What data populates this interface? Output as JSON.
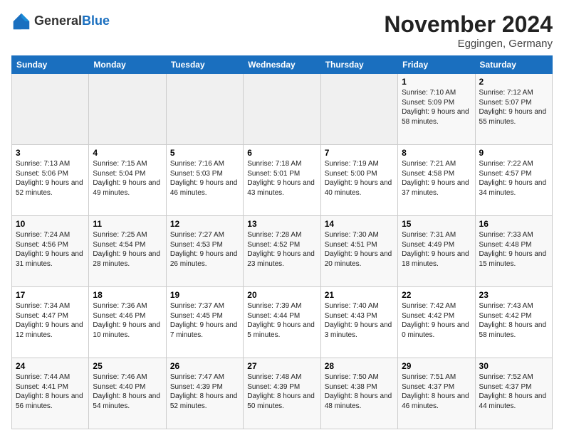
{
  "header": {
    "logo_line1": "General",
    "logo_line2": "Blue",
    "month_title": "November 2024",
    "location": "Eggingen, Germany"
  },
  "weekdays": [
    "Sunday",
    "Monday",
    "Tuesday",
    "Wednesday",
    "Thursday",
    "Friday",
    "Saturday"
  ],
  "weeks": [
    [
      {
        "day": "",
        "info": ""
      },
      {
        "day": "",
        "info": ""
      },
      {
        "day": "",
        "info": ""
      },
      {
        "day": "",
        "info": ""
      },
      {
        "day": "",
        "info": ""
      },
      {
        "day": "1",
        "info": "Sunrise: 7:10 AM\nSunset: 5:09 PM\nDaylight: 9 hours and 58 minutes."
      },
      {
        "day": "2",
        "info": "Sunrise: 7:12 AM\nSunset: 5:07 PM\nDaylight: 9 hours and 55 minutes."
      }
    ],
    [
      {
        "day": "3",
        "info": "Sunrise: 7:13 AM\nSunset: 5:06 PM\nDaylight: 9 hours and 52 minutes."
      },
      {
        "day": "4",
        "info": "Sunrise: 7:15 AM\nSunset: 5:04 PM\nDaylight: 9 hours and 49 minutes."
      },
      {
        "day": "5",
        "info": "Sunrise: 7:16 AM\nSunset: 5:03 PM\nDaylight: 9 hours and 46 minutes."
      },
      {
        "day": "6",
        "info": "Sunrise: 7:18 AM\nSunset: 5:01 PM\nDaylight: 9 hours and 43 minutes."
      },
      {
        "day": "7",
        "info": "Sunrise: 7:19 AM\nSunset: 5:00 PM\nDaylight: 9 hours and 40 minutes."
      },
      {
        "day": "8",
        "info": "Sunrise: 7:21 AM\nSunset: 4:58 PM\nDaylight: 9 hours and 37 minutes."
      },
      {
        "day": "9",
        "info": "Sunrise: 7:22 AM\nSunset: 4:57 PM\nDaylight: 9 hours and 34 minutes."
      }
    ],
    [
      {
        "day": "10",
        "info": "Sunrise: 7:24 AM\nSunset: 4:56 PM\nDaylight: 9 hours and 31 minutes."
      },
      {
        "day": "11",
        "info": "Sunrise: 7:25 AM\nSunset: 4:54 PM\nDaylight: 9 hours and 28 minutes."
      },
      {
        "day": "12",
        "info": "Sunrise: 7:27 AM\nSunset: 4:53 PM\nDaylight: 9 hours and 26 minutes."
      },
      {
        "day": "13",
        "info": "Sunrise: 7:28 AM\nSunset: 4:52 PM\nDaylight: 9 hours and 23 minutes."
      },
      {
        "day": "14",
        "info": "Sunrise: 7:30 AM\nSunset: 4:51 PM\nDaylight: 9 hours and 20 minutes."
      },
      {
        "day": "15",
        "info": "Sunrise: 7:31 AM\nSunset: 4:49 PM\nDaylight: 9 hours and 18 minutes."
      },
      {
        "day": "16",
        "info": "Sunrise: 7:33 AM\nSunset: 4:48 PM\nDaylight: 9 hours and 15 minutes."
      }
    ],
    [
      {
        "day": "17",
        "info": "Sunrise: 7:34 AM\nSunset: 4:47 PM\nDaylight: 9 hours and 12 minutes."
      },
      {
        "day": "18",
        "info": "Sunrise: 7:36 AM\nSunset: 4:46 PM\nDaylight: 9 hours and 10 minutes."
      },
      {
        "day": "19",
        "info": "Sunrise: 7:37 AM\nSunset: 4:45 PM\nDaylight: 9 hours and 7 minutes."
      },
      {
        "day": "20",
        "info": "Sunrise: 7:39 AM\nSunset: 4:44 PM\nDaylight: 9 hours and 5 minutes."
      },
      {
        "day": "21",
        "info": "Sunrise: 7:40 AM\nSunset: 4:43 PM\nDaylight: 9 hours and 3 minutes."
      },
      {
        "day": "22",
        "info": "Sunrise: 7:42 AM\nSunset: 4:42 PM\nDaylight: 9 hours and 0 minutes."
      },
      {
        "day": "23",
        "info": "Sunrise: 7:43 AM\nSunset: 4:42 PM\nDaylight: 8 hours and 58 minutes."
      }
    ],
    [
      {
        "day": "24",
        "info": "Sunrise: 7:44 AM\nSunset: 4:41 PM\nDaylight: 8 hours and 56 minutes."
      },
      {
        "day": "25",
        "info": "Sunrise: 7:46 AM\nSunset: 4:40 PM\nDaylight: 8 hours and 54 minutes."
      },
      {
        "day": "26",
        "info": "Sunrise: 7:47 AM\nSunset: 4:39 PM\nDaylight: 8 hours and 52 minutes."
      },
      {
        "day": "27",
        "info": "Sunrise: 7:48 AM\nSunset: 4:39 PM\nDaylight: 8 hours and 50 minutes."
      },
      {
        "day": "28",
        "info": "Sunrise: 7:50 AM\nSunset: 4:38 PM\nDaylight: 8 hours and 48 minutes."
      },
      {
        "day": "29",
        "info": "Sunrise: 7:51 AM\nSunset: 4:37 PM\nDaylight: 8 hours and 46 minutes."
      },
      {
        "day": "30",
        "info": "Sunrise: 7:52 AM\nSunset: 4:37 PM\nDaylight: 8 hours and 44 minutes."
      }
    ]
  ]
}
